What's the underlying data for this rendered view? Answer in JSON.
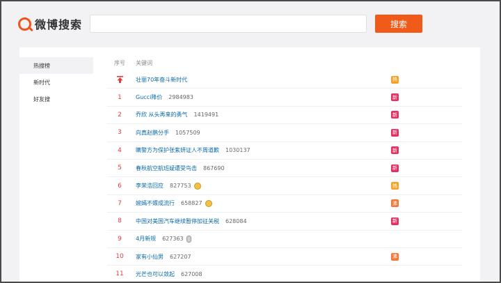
{
  "header": {
    "logo_text": "微博搜索",
    "search_placeholder": "",
    "search_button": "搜索",
    "accent": "#f15b19"
  },
  "sidebar": {
    "items": [
      {
        "label": "热搜榜",
        "active": true
      },
      {
        "label": "新时代",
        "active": false
      },
      {
        "label": "好友搜",
        "active": false
      }
    ]
  },
  "table": {
    "col_rank": "序号",
    "col_keyword": "关键词",
    "rows": [
      {
        "rank": "",
        "pinned": true,
        "keyword": "壮丽70年奋斗新时代",
        "count": "",
        "emoji": "",
        "badge": "热",
        "badge_type": "hot"
      },
      {
        "rank": "1",
        "keyword": "Gucci降价",
        "count": "2984983",
        "emoji": "",
        "badge": "新",
        "badge_type": "new"
      },
      {
        "rank": "2",
        "keyword": "乔欣 从头再来的勇气",
        "count": "1419491",
        "emoji": "",
        "badge": "新",
        "badge_type": "new"
      },
      {
        "rank": "3",
        "keyword": "向真赵鹏分手",
        "count": "1057509",
        "emoji": "",
        "badge": "新",
        "badge_type": "new"
      },
      {
        "rank": "4",
        "keyword": "瞒警方为保护张紫妍证人不周道歉",
        "count": "1030137",
        "emoji": "",
        "badge": "新",
        "badge_type": "new"
      },
      {
        "rank": "5",
        "keyword": "春秋航空航班疑遭受鸟击",
        "count": "867690",
        "emoji": "",
        "badge": "新",
        "badge_type": "new"
      },
      {
        "rank": "6",
        "keyword": "李荣浩回应",
        "count": "827753",
        "emoji": "laugh-emoji",
        "badge": "热",
        "badge_type": "hot"
      },
      {
        "rank": "7",
        "keyword": "婉嫣不嫖成流行",
        "count": "658827",
        "emoji": "ring-emoji",
        "badge": "沸",
        "badge_type": "boil"
      },
      {
        "rank": "8",
        "keyword": "中国对美国汽车继续暂停加征关税",
        "count": "628084",
        "emoji": "",
        "badge": "新",
        "badge_type": "new"
      },
      {
        "rank": "9",
        "keyword": "4月新规",
        "count": "627363",
        "emoji": "doc-emoji",
        "badge": "",
        "badge_type": ""
      },
      {
        "rank": "10",
        "keyword": "家有小仙男",
        "count": "627207",
        "emoji": "",
        "badge": "沸",
        "badge_type": "boil"
      },
      {
        "rank": "11",
        "keyword": "光芒也可以敛起",
        "count": "627008",
        "emoji": "",
        "badge": "",
        "badge_type": ""
      }
    ]
  }
}
